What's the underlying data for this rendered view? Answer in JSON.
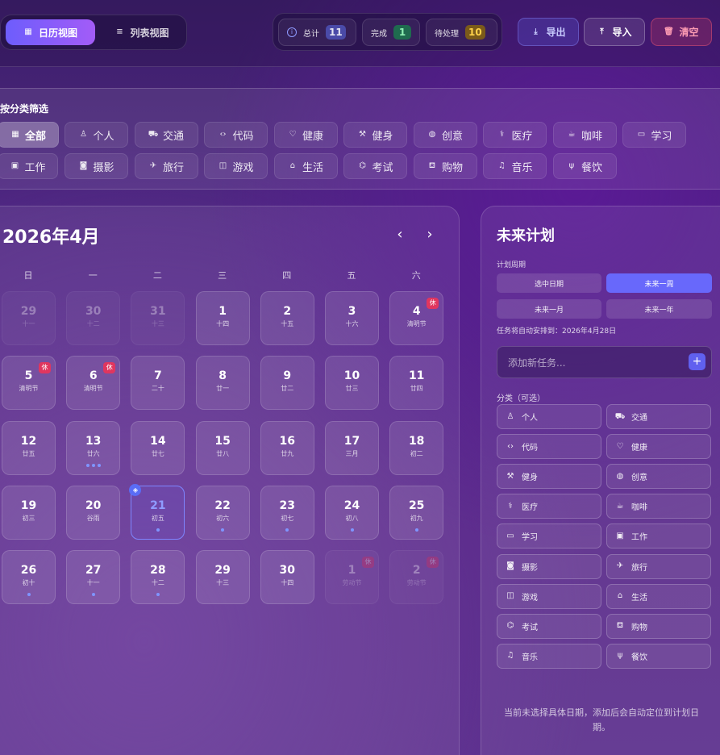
{
  "toolbar": {
    "calendar_view": "日历视图",
    "list_view": "列表视图",
    "stats": [
      {
        "label": "总计",
        "value": "11",
        "bg": "#4a4aa8",
        "color": "#fff"
      },
      {
        "label": "完成",
        "value": "1",
        "bg": "#1f6b4f",
        "color": "#8ff0b4"
      },
      {
        "label": "待处理",
        "value": "10",
        "bg": "#7a5a1a",
        "color": "#ffd24a"
      }
    ],
    "export": "导出",
    "import": "导入",
    "clear": "清空"
  },
  "filter": {
    "title": "按分类筛选",
    "chips": [
      {
        "label": "全部",
        "icon": "grid-icon",
        "glyph": "▦"
      },
      {
        "label": "个人",
        "icon": "person-icon",
        "glyph": "♙"
      },
      {
        "label": "交通",
        "icon": "car-icon",
        "glyph": "⛟"
      },
      {
        "label": "代码",
        "icon": "code-icon",
        "glyph": "‹›"
      },
      {
        "label": "健康",
        "icon": "heart-icon",
        "glyph": "♡"
      },
      {
        "label": "健身",
        "icon": "dumbbell-icon",
        "glyph": "⚒"
      },
      {
        "label": "创意",
        "icon": "palette-icon",
        "glyph": "◍"
      },
      {
        "label": "医疗",
        "icon": "stethoscope-icon",
        "glyph": "⚕"
      },
      {
        "label": "咖啡",
        "icon": "coffee-icon",
        "glyph": "☕"
      },
      {
        "label": "学习",
        "icon": "book-icon",
        "glyph": "▭"
      },
      {
        "label": "工作",
        "icon": "briefcase-icon",
        "glyph": "▣"
      },
      {
        "label": "摄影",
        "icon": "camera-icon",
        "glyph": "◙"
      },
      {
        "label": "旅行",
        "icon": "plane-icon",
        "glyph": "✈"
      },
      {
        "label": "游戏",
        "icon": "gamepad-icon",
        "glyph": "◫"
      },
      {
        "label": "生活",
        "icon": "home-icon",
        "glyph": "⌂"
      },
      {
        "label": "考试",
        "icon": "graduation-cap-icon",
        "glyph": "⌬"
      },
      {
        "label": "购物",
        "icon": "cart-icon",
        "glyph": "⛾"
      },
      {
        "label": "音乐",
        "icon": "music-icon",
        "glyph": "♫"
      },
      {
        "label": "餐饮",
        "icon": "utensils-icon",
        "glyph": "ψ"
      }
    ]
  },
  "calendar": {
    "title": "2026年4月",
    "prev": "‹",
    "next": "›",
    "weekdays": [
      "日",
      "一",
      "二",
      "三",
      "四",
      "五",
      "六"
    ],
    "rest_label": "休",
    "days": [
      {
        "n": "29",
        "l": "十一",
        "other": true
      },
      {
        "n": "30",
        "l": "十二",
        "other": true
      },
      {
        "n": "31",
        "l": "十三",
        "other": true
      },
      {
        "n": "1",
        "l": "十四"
      },
      {
        "n": "2",
        "l": "十五"
      },
      {
        "n": "3",
        "l": "十六"
      },
      {
        "n": "4",
        "l": "清明节",
        "rest": true
      },
      {
        "n": "5",
        "l": "清明节",
        "rest": true
      },
      {
        "n": "6",
        "l": "清明节",
        "rest": true
      },
      {
        "n": "7",
        "l": "二十"
      },
      {
        "n": "8",
        "l": "廿一"
      },
      {
        "n": "9",
        "l": "廿二"
      },
      {
        "n": "10",
        "l": "廿三"
      },
      {
        "n": "11",
        "l": "廿四"
      },
      {
        "n": "12",
        "l": "廿五"
      },
      {
        "n": "13",
        "l": "廿六",
        "dots": 3
      },
      {
        "n": "14",
        "l": "廿七"
      },
      {
        "n": "15",
        "l": "廿八"
      },
      {
        "n": "16",
        "l": "廿九"
      },
      {
        "n": "17",
        "l": "三月"
      },
      {
        "n": "18",
        "l": "初二"
      },
      {
        "n": "19",
        "l": "初三"
      },
      {
        "n": "20",
        "l": "谷雨"
      },
      {
        "n": "21",
        "l": "初五",
        "dots": 1,
        "selected": true,
        "today": true
      },
      {
        "n": "22",
        "l": "初六",
        "dots": 1
      },
      {
        "n": "23",
        "l": "初七",
        "dots": 1
      },
      {
        "n": "24",
        "l": "初八",
        "dots": 1
      },
      {
        "n": "25",
        "l": "初九",
        "dots": 1
      },
      {
        "n": "26",
        "l": "初十",
        "dots": 1
      },
      {
        "n": "27",
        "l": "十一",
        "dots": 1
      },
      {
        "n": "28",
        "l": "十二",
        "dots": 1
      },
      {
        "n": "29",
        "l": "十三"
      },
      {
        "n": "30",
        "l": "十四"
      },
      {
        "n": "1",
        "l": "劳动节",
        "other": true,
        "rest": true
      },
      {
        "n": "2",
        "l": "劳动节",
        "other": true,
        "rest": true
      }
    ]
  },
  "planner": {
    "title": "未来计划",
    "period_label": "计划周期",
    "periods": [
      {
        "label": "选中日期"
      },
      {
        "label": "未来一周",
        "active": true
      },
      {
        "label": "未来一月"
      },
      {
        "label": "未来一年"
      }
    ],
    "schedule_note": "任务将自动安排到：2026年4月28日",
    "task_placeholder": "添加新任务...",
    "add": "+",
    "category_label": "分类（可选）",
    "categories": [
      {
        "label": "个人",
        "icon": "person-icon",
        "glyph": "♙"
      },
      {
        "label": "交通",
        "icon": "car-icon",
        "glyph": "⛟"
      },
      {
        "label": "代码",
        "icon": "code-icon",
        "glyph": "‹›"
      },
      {
        "label": "健康",
        "icon": "heart-icon",
        "glyph": "♡"
      },
      {
        "label": "健身",
        "icon": "dumbbell-icon",
        "glyph": "⚒"
      },
      {
        "label": "创意",
        "icon": "palette-icon",
        "glyph": "◍"
      },
      {
        "label": "医疗",
        "icon": "stethoscope-icon",
        "glyph": "⚕"
      },
      {
        "label": "咖啡",
        "icon": "coffee-icon",
        "glyph": "☕"
      },
      {
        "label": "学习",
        "icon": "book-icon",
        "glyph": "▭"
      },
      {
        "label": "工作",
        "icon": "briefcase-icon",
        "glyph": "▣"
      },
      {
        "label": "摄影",
        "icon": "camera-icon",
        "glyph": "◙"
      },
      {
        "label": "旅行",
        "icon": "plane-icon",
        "glyph": "✈"
      },
      {
        "label": "游戏",
        "icon": "gamepad-icon",
        "glyph": "◫"
      },
      {
        "label": "生活",
        "icon": "home-icon",
        "glyph": "⌂"
      },
      {
        "label": "考试",
        "icon": "graduation-cap-icon",
        "glyph": "⌬"
      },
      {
        "label": "购物",
        "icon": "cart-icon",
        "glyph": "⛾"
      },
      {
        "label": "音乐",
        "icon": "music-icon",
        "glyph": "♫"
      },
      {
        "label": "餐饮",
        "icon": "utensils-icon",
        "glyph": "ψ"
      }
    ],
    "hint": "当前未选择具体日期，添加后会自动定位到计划日期。"
  }
}
